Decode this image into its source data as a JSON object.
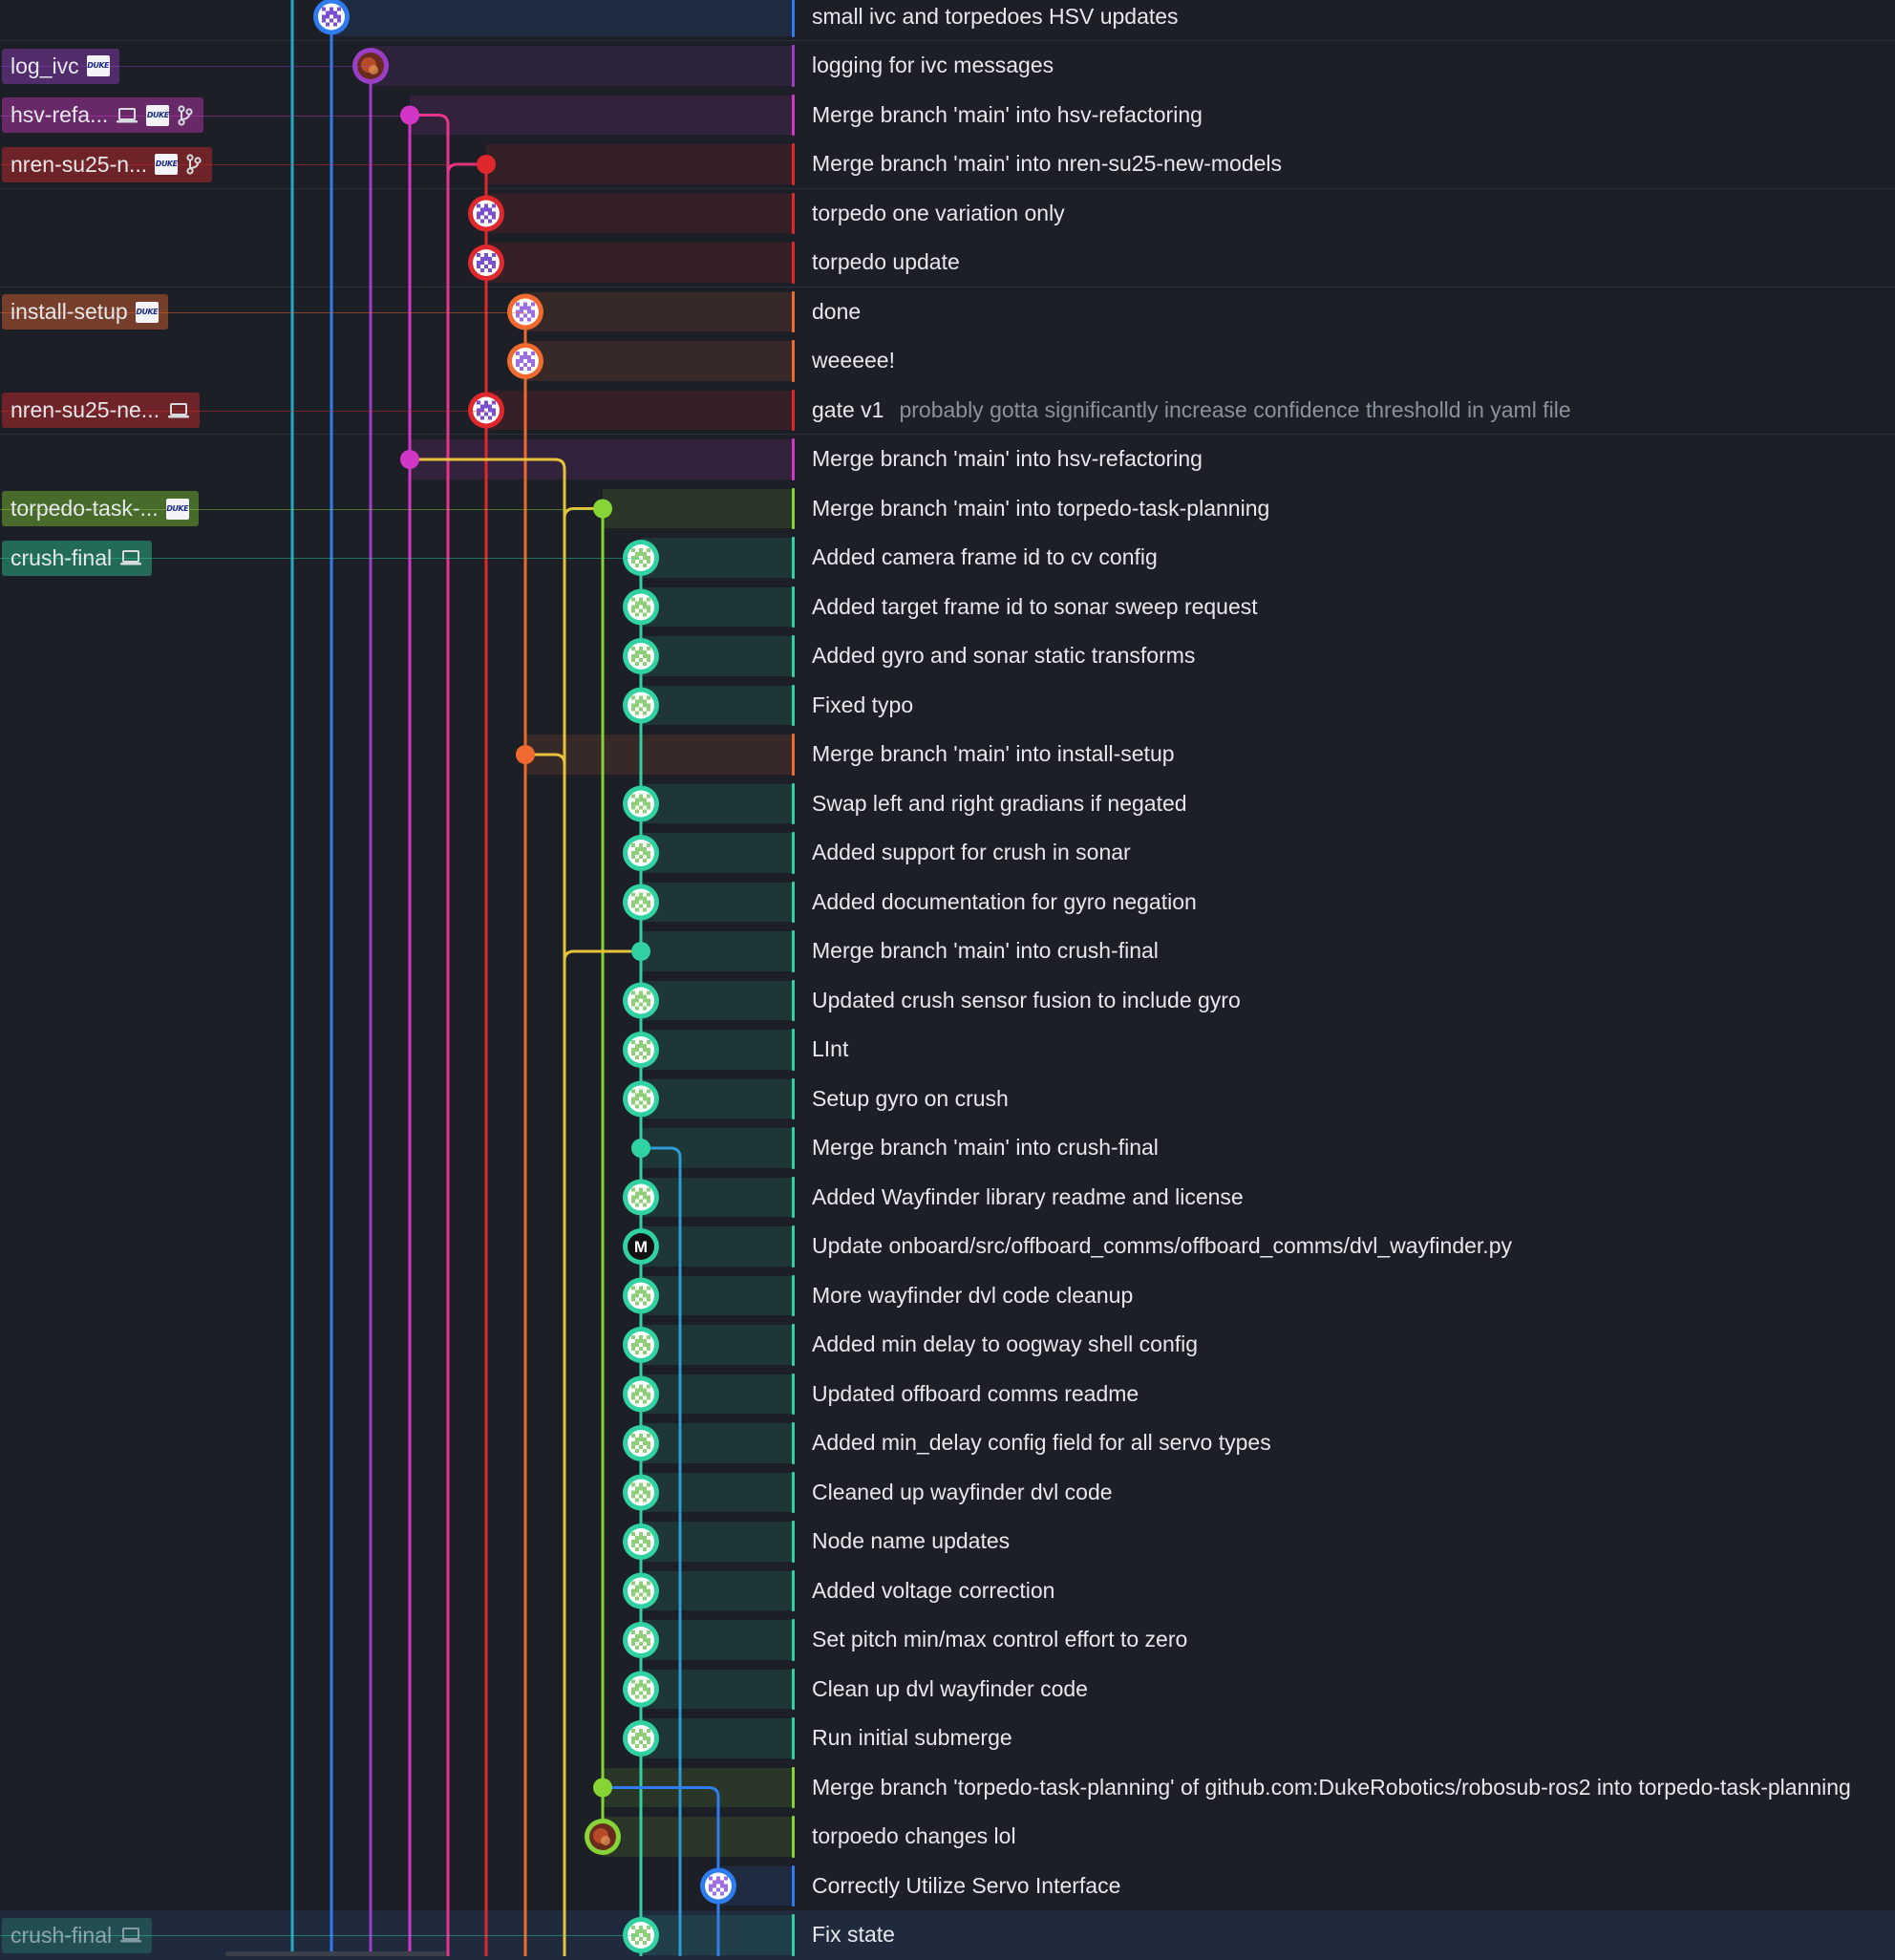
{
  "colors": {
    "background": "#1c1f26",
    "cyan": "#28a8c8",
    "blue": "#2f7cf0",
    "purple": "#9a3ec8",
    "magenta": "#d236c6",
    "pink": "#e8348c",
    "red": "#e0282c",
    "orange": "#f06a30",
    "yellow": "#e9c23c",
    "lime": "#86d435",
    "teal": "#2fd2a0",
    "sky": "#2d9bd6"
  },
  "labels": [
    {
      "row": 1,
      "text": "log_ivc",
      "color": "purple",
      "icons": [
        "org-avatar-icon"
      ]
    },
    {
      "row": 2,
      "text": "hsv-refa...",
      "color": "magenta",
      "icons": [
        "laptop-icon",
        "org-avatar-icon",
        "branch-icon"
      ]
    },
    {
      "row": 3,
      "text": "nren-su25-n...",
      "color": "red",
      "icons": [
        "org-avatar-icon",
        "branch-icon"
      ]
    },
    {
      "row": 6,
      "text": "install-setup",
      "color": "orange",
      "icons": [
        "org-avatar-icon"
      ]
    },
    {
      "row": 8,
      "text": "nren-su25-ne...",
      "color": "red",
      "icons": [
        "laptop-icon"
      ]
    },
    {
      "row": 10,
      "text": "torpedo-task-...",
      "color": "lime",
      "icons": [
        "org-avatar-icon"
      ]
    },
    {
      "row": 11,
      "text": "crush-final",
      "color": "teal",
      "icons": [
        "laptop-icon"
      ]
    },
    {
      "row": 39,
      "text": "crush-final",
      "color": "teal",
      "icons": [
        "laptop-icon"
      ],
      "dim": true
    }
  ],
  "org_avatar_text": "DUKE",
  "commits": [
    {
      "message": "small ivc and torpedoes HSV updates",
      "color": "blue",
      "lane": 1,
      "node": "avatar",
      "avatar": "purple-pixel"
    },
    {
      "message": "logging for ivc messages",
      "color": "purple",
      "lane": 2,
      "node": "avatar",
      "avatar": "photo"
    },
    {
      "message": "Merge branch 'main' into hsv-refactoring",
      "color": "magenta",
      "lane": 3,
      "node": "dot"
    },
    {
      "message": "Merge branch 'main' into nren-su25-new-models",
      "color": "red",
      "lane": 5,
      "node": "dot"
    },
    {
      "message": "torpedo one variation only",
      "color": "red",
      "lane": 5,
      "node": "avatar",
      "avatar": "purple-pixel"
    },
    {
      "message": "torpedo update",
      "color": "red",
      "lane": 5,
      "node": "avatar",
      "avatar": "purple-pixel"
    },
    {
      "message": "done",
      "color": "orange",
      "lane": 6,
      "node": "avatar",
      "avatar": "violet-pixel"
    },
    {
      "message": "weeeee!",
      "color": "orange",
      "lane": 6,
      "node": "avatar",
      "avatar": "violet-pixel"
    },
    {
      "message": "gate v1",
      "description": "probably gotta significantly increase confidence thresholld in yaml file",
      "color": "red",
      "lane": 5,
      "node": "avatar",
      "avatar": "purple-pixel"
    },
    {
      "message": "Merge branch 'main' into hsv-refactoring",
      "color": "magenta",
      "lane": 3,
      "node": "dot"
    },
    {
      "message": "Merge branch 'main' into torpedo-task-planning",
      "color": "lime",
      "lane": 8,
      "node": "dot"
    },
    {
      "message": "Added camera frame id to cv config",
      "color": "teal",
      "lane": 9,
      "node": "avatar",
      "avatar": "green-pixel"
    },
    {
      "message": "Added target frame id to sonar sweep request",
      "color": "teal",
      "lane": 9,
      "node": "avatar",
      "avatar": "green-pixel"
    },
    {
      "message": "Added gyro and sonar static transforms",
      "color": "teal",
      "lane": 9,
      "node": "avatar",
      "avatar": "green-pixel"
    },
    {
      "message": "Fixed typo",
      "color": "teal",
      "lane": 9,
      "node": "avatar",
      "avatar": "green-pixel"
    },
    {
      "message": "Merge branch 'main' into install-setup",
      "color": "orange",
      "lane": 6,
      "node": "dot"
    },
    {
      "message": "Swap left and right gradians if negated",
      "color": "teal",
      "lane": 9,
      "node": "avatar",
      "avatar": "green-pixel"
    },
    {
      "message": "Added support for crush in sonar",
      "color": "teal",
      "lane": 9,
      "node": "avatar",
      "avatar": "green-pixel"
    },
    {
      "message": "Added documentation for gyro negation",
      "color": "teal",
      "lane": 9,
      "node": "avatar",
      "avatar": "green-pixel"
    },
    {
      "message": "Merge branch 'main' into crush-final",
      "color": "teal",
      "lane": 9,
      "node": "dot"
    },
    {
      "message": "Updated crush sensor fusion to include gyro",
      "color": "teal",
      "lane": 9,
      "node": "avatar",
      "avatar": "green-pixel"
    },
    {
      "message": "LInt",
      "color": "teal",
      "lane": 9,
      "node": "avatar",
      "avatar": "green-pixel"
    },
    {
      "message": "Setup gyro on crush",
      "color": "teal",
      "lane": 9,
      "node": "avatar",
      "avatar": "green-pixel"
    },
    {
      "message": "Merge branch 'main' into crush-final",
      "color": "teal",
      "lane": 9,
      "node": "dot"
    },
    {
      "message": "Added Wayfinder library readme and license",
      "color": "teal",
      "lane": 9,
      "node": "avatar",
      "avatar": "green-pixel"
    },
    {
      "message": "Update onboard/src/offboard_comms/offboard_comms/dvl_wayfinder.py",
      "color": "teal",
      "lane": 9,
      "node": "avatar",
      "avatar": "m-logo",
      "avatar_text": "M"
    },
    {
      "message": "More wayfinder dvl code cleanup",
      "color": "teal",
      "lane": 9,
      "node": "avatar",
      "avatar": "green-pixel"
    },
    {
      "message": "Added min delay to oogway shell config",
      "color": "teal",
      "lane": 9,
      "node": "avatar",
      "avatar": "green-pixel"
    },
    {
      "message": "Updated offboard comms readme",
      "color": "teal",
      "lane": 9,
      "node": "avatar",
      "avatar": "green-pixel"
    },
    {
      "message": "Added min_delay config field for all servo types",
      "color": "teal",
      "lane": 9,
      "node": "avatar",
      "avatar": "green-pixel"
    },
    {
      "message": "Cleaned up wayfinder dvl code",
      "color": "teal",
      "lane": 9,
      "node": "avatar",
      "avatar": "green-pixel"
    },
    {
      "message": "Node name updates",
      "color": "teal",
      "lane": 9,
      "node": "avatar",
      "avatar": "green-pixel"
    },
    {
      "message": "Added voltage correction",
      "color": "teal",
      "lane": 9,
      "node": "avatar",
      "avatar": "green-pixel"
    },
    {
      "message": "Set pitch min/max control effort to zero",
      "color": "teal",
      "lane": 9,
      "node": "avatar",
      "avatar": "green-pixel"
    },
    {
      "message": "Clean up dvl wayfinder code",
      "color": "teal",
      "lane": 9,
      "node": "avatar",
      "avatar": "green-pixel"
    },
    {
      "message": "Run initial submerge",
      "color": "teal",
      "lane": 9,
      "node": "avatar",
      "avatar": "green-pixel"
    },
    {
      "message": "Merge branch 'torpedo-task-planning' of github.com:DukeRobotics/robosub-ros2 into torpedo-task-planning",
      "color": "lime",
      "lane": 8,
      "node": "dot"
    },
    {
      "message": "torpoedo changes lol",
      "color": "lime",
      "lane": 8,
      "node": "avatar",
      "avatar": "photo"
    },
    {
      "message": "Correctly Utilize Servo Interface",
      "color": "blue",
      "lane": 11,
      "node": "avatar",
      "avatar": "violet-pixel"
    },
    {
      "message": "Fix state",
      "color": "teal",
      "lane": 9,
      "node": "avatar",
      "avatar": "green-pixel",
      "selected": true
    }
  ],
  "lanes": [
    {
      "color": "cyan"
    },
    {
      "color": "blue"
    },
    {
      "color": "purple"
    },
    {
      "color": "magenta"
    },
    {
      "color": "pink"
    },
    {
      "color": "red"
    },
    {
      "color": "orange"
    },
    {
      "color": "yellow"
    },
    {
      "color": "lime"
    },
    {
      "color": "teal"
    },
    {
      "color": "sky"
    },
    {
      "color": "blue"
    }
  ],
  "separators_after_rows": [
    0,
    3,
    5,
    8
  ]
}
